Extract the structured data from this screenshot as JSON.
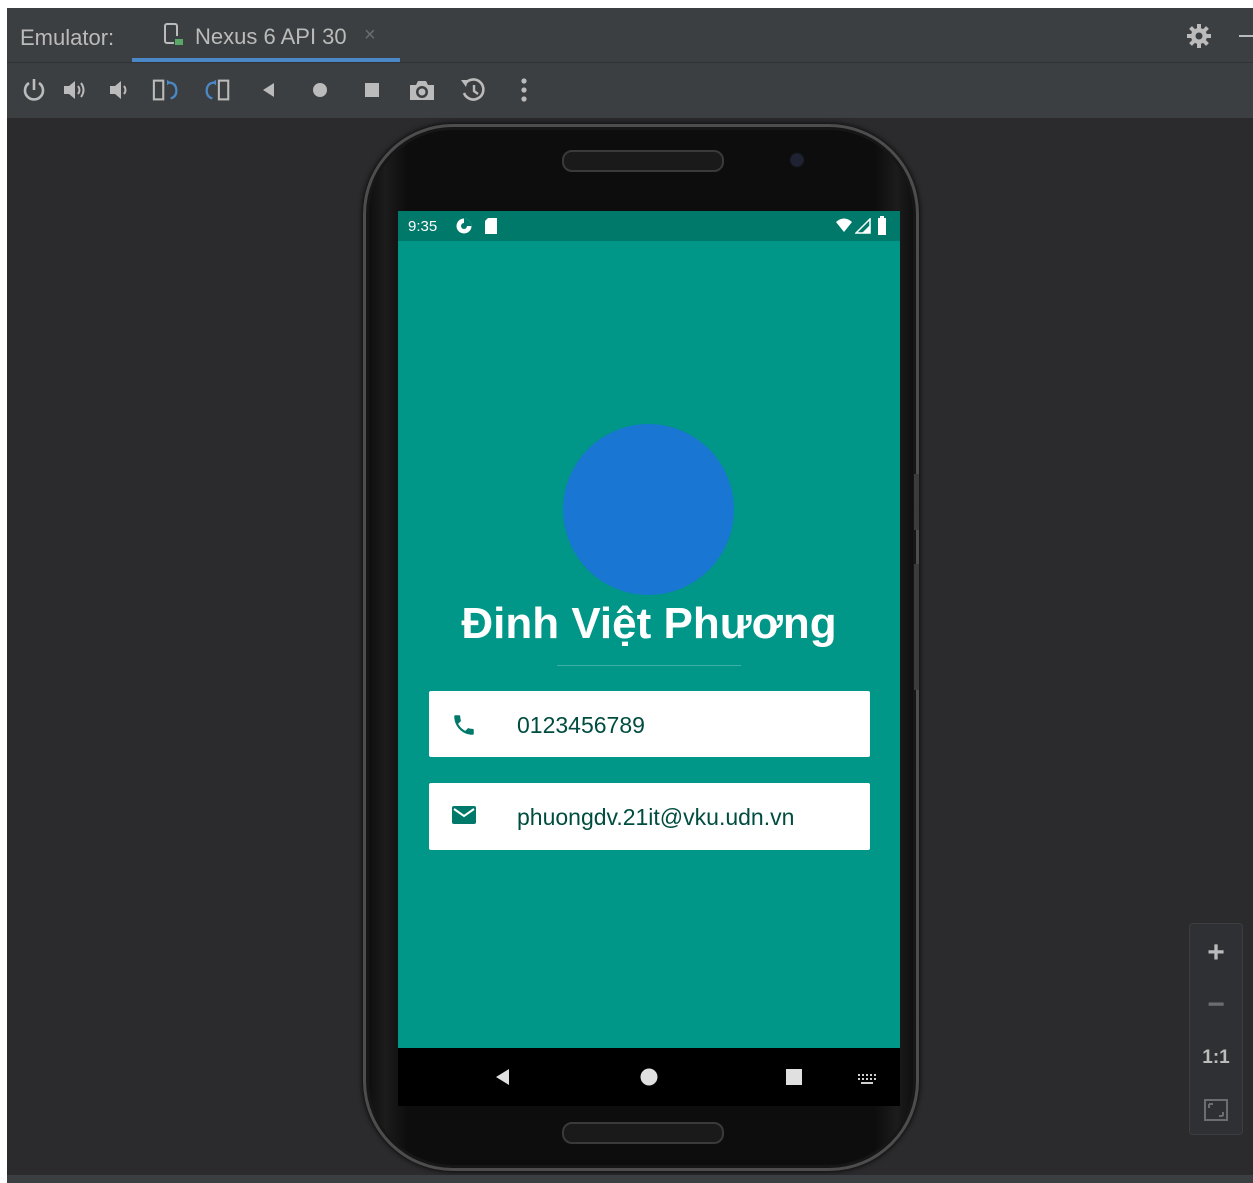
{
  "ide": {
    "panel_label": "Emulator:",
    "tab_title": "Nexus 6 API 30",
    "tab_close": "×",
    "toolbar": [
      {
        "name": "power-icon"
      },
      {
        "name": "volume-up-icon"
      },
      {
        "name": "volume-down-icon"
      },
      {
        "name": "rotate-left-icon"
      },
      {
        "name": "rotate-right-icon"
      },
      {
        "name": "back-icon"
      },
      {
        "name": "home-icon"
      },
      {
        "name": "overview-icon"
      },
      {
        "name": "camera-icon"
      },
      {
        "name": "snapshot-icon"
      },
      {
        "name": "more-icon"
      }
    ],
    "zoom": {
      "zoom_in": "+",
      "zoom_out": "−",
      "actual_size": "1:1"
    }
  },
  "device": {
    "status": {
      "time": "9:35"
    },
    "profile": {
      "name": "Đinh Việt Phương",
      "phone": "0123456789",
      "email": "phuongdv.21it@vku.udn.vn"
    }
  },
  "colors": {
    "app_background": "#009688",
    "status_bar": "#00796b",
    "avatar": "#1976d2",
    "card_text": "#004d40",
    "tab_accent": "#4a88c7"
  }
}
